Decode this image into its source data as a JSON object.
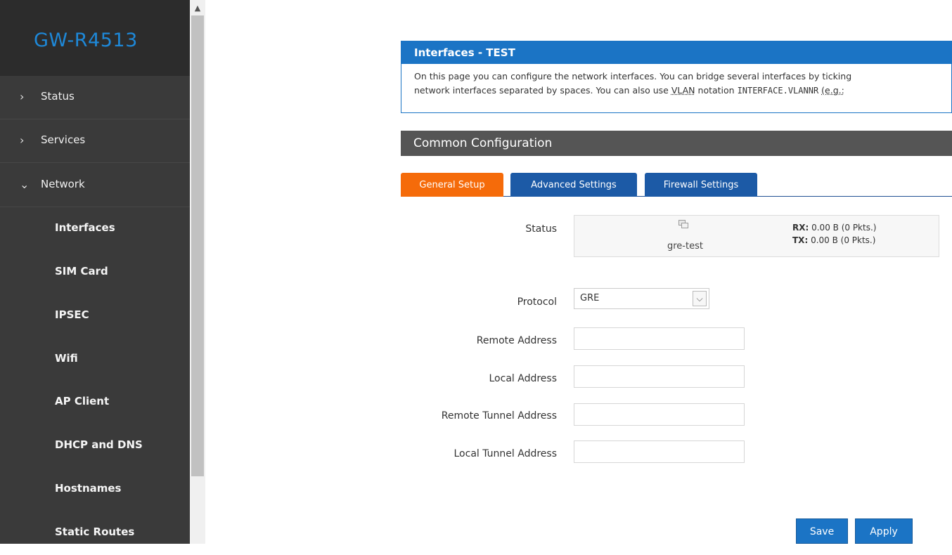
{
  "brand": {
    "title": "GW-R4513"
  },
  "sidebar": {
    "sections": [
      {
        "label": "Status",
        "expanded": false
      },
      {
        "label": "Services",
        "expanded": false
      },
      {
        "label": "Network",
        "expanded": true
      }
    ],
    "network_items": [
      {
        "label": "Interfaces"
      },
      {
        "label": "SIM Card"
      },
      {
        "label": "IPSEC"
      },
      {
        "label": "Wifi"
      },
      {
        "label": "AP Client"
      },
      {
        "label": "DHCP and DNS"
      },
      {
        "label": "Hostnames"
      },
      {
        "label": "Static Routes"
      }
    ]
  },
  "page": {
    "title": "Interfaces - TEST",
    "description_line1": "On this page you can configure the network interfaces. You can bridge several interfaces by ticking",
    "description_line2_a": "network interfaces separated by spaces. You can also use ",
    "description_vlan": "VLAN",
    "description_line2_b": " notation ",
    "description_code": "INTERFACE.VLANNR",
    "description_line2_c": " ",
    "description_eg": "(e.g.:",
    "section_title": "Common Configuration"
  },
  "tabs": [
    {
      "label": "General Setup",
      "active": true
    },
    {
      "label": "Advanced Settings",
      "active": false
    },
    {
      "label": "Firewall Settings",
      "active": false
    }
  ],
  "status": {
    "label": "Status",
    "interface": "gre-test",
    "rx_label": "RX:",
    "rx_value": " 0.00 B (0 Pkts.)",
    "tx_label": "TX:",
    "tx_value": " 0.00 B (0 Pkts.)"
  },
  "form": {
    "protocol_label": "Protocol",
    "protocol_value": "GRE",
    "remote_address_label": "Remote Address",
    "remote_address_value": "",
    "local_address_label": "Local Address",
    "local_address_value": "",
    "remote_tunnel_label": "Remote Tunnel Address",
    "remote_tunnel_value": "",
    "local_tunnel_label": "Local Tunnel Address",
    "local_tunnel_value": ""
  },
  "buttons": {
    "save": "Save",
    "apply": "Apply"
  },
  "colors": {
    "accent_blue": "#1b74c5",
    "active_tab": "#f56b0a",
    "sidebar_bg": "#3a3a3a",
    "brand_color": "#1e88d8"
  }
}
